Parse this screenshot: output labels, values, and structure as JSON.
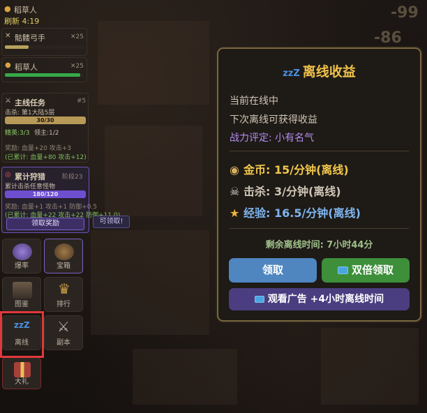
{
  "damage_numbers": [
    "-99",
    "-86"
  ],
  "top_monster": {
    "name": "稻草人",
    "refresh": "刷新 4:19"
  },
  "monsters": [
    {
      "name": "骷髅弓手",
      "count": "✕25",
      "hp_fraction": 0.3,
      "color": "#b8a25a"
    },
    {
      "name": "稻草人",
      "count": "✕25",
      "hp_fraction": 0.95,
      "color": "#37a84a"
    }
  ],
  "main_quest": {
    "title": "主线任务",
    "number": "#5",
    "objective": "击杀: 第1大陆5层",
    "progress_text": "30/30",
    "progress_fraction": 1.0,
    "elite": "精英:3/3",
    "boss": "领主:1/2",
    "reward": "奖励: 血量+20 攻击+3",
    "accumulated": "(已累计: 血量+80 攻击+12)"
  },
  "hunt": {
    "title": "累计狩猎",
    "stage": "阶段23",
    "objective": "累计击杀任意怪物",
    "progress_text": "180/120",
    "progress_fraction": 1.0,
    "reward": "奖励: 血量+1 攻击+1 防御+0.5",
    "accumulated": "(已累计: 血量+22 攻击+22 防御+11.0)",
    "claim_label": "领取奖励",
    "tooltip": "可领取!"
  },
  "grid": [
    {
      "name": "drop-rate",
      "label": "爆率",
      "icon": "orb-icon"
    },
    {
      "name": "chest",
      "label": "宝箱",
      "icon": "chest-icon"
    },
    {
      "name": "codex",
      "label": "图鉴",
      "icon": "book-icon"
    },
    {
      "name": "ranking",
      "label": "排行",
      "icon": "trophy-icon"
    },
    {
      "name": "offline",
      "label": "离线",
      "icon": "sleep-icon"
    },
    {
      "name": "dungeon",
      "label": "副本",
      "icon": "crossed-swords-icon"
    },
    {
      "name": "gift",
      "label": "大礼",
      "icon": "gift-icon"
    }
  ],
  "dialog": {
    "title": "离线收益",
    "title_icon": "zzZ",
    "status": "当前在线中",
    "next": "下次离线可获得收益",
    "rating_label": "战力评定:",
    "rating_value": "小有名气",
    "gold": "金币: 15/分钟(离线)",
    "kills": "击杀: 3/分钟(离线)",
    "exp": "经验: 16.5/分钟(离线)",
    "remaining": "剩余离线时间: 7小时44分",
    "claim_label": "领取",
    "double_label": "双倍领取",
    "ad_label": "观看广告 +4小时离线时间",
    "colors": {
      "gold": "#f2c84b",
      "rating": "#b48cf0",
      "exp": "#7fb6f0",
      "remaining": "#9fc08a"
    }
  }
}
